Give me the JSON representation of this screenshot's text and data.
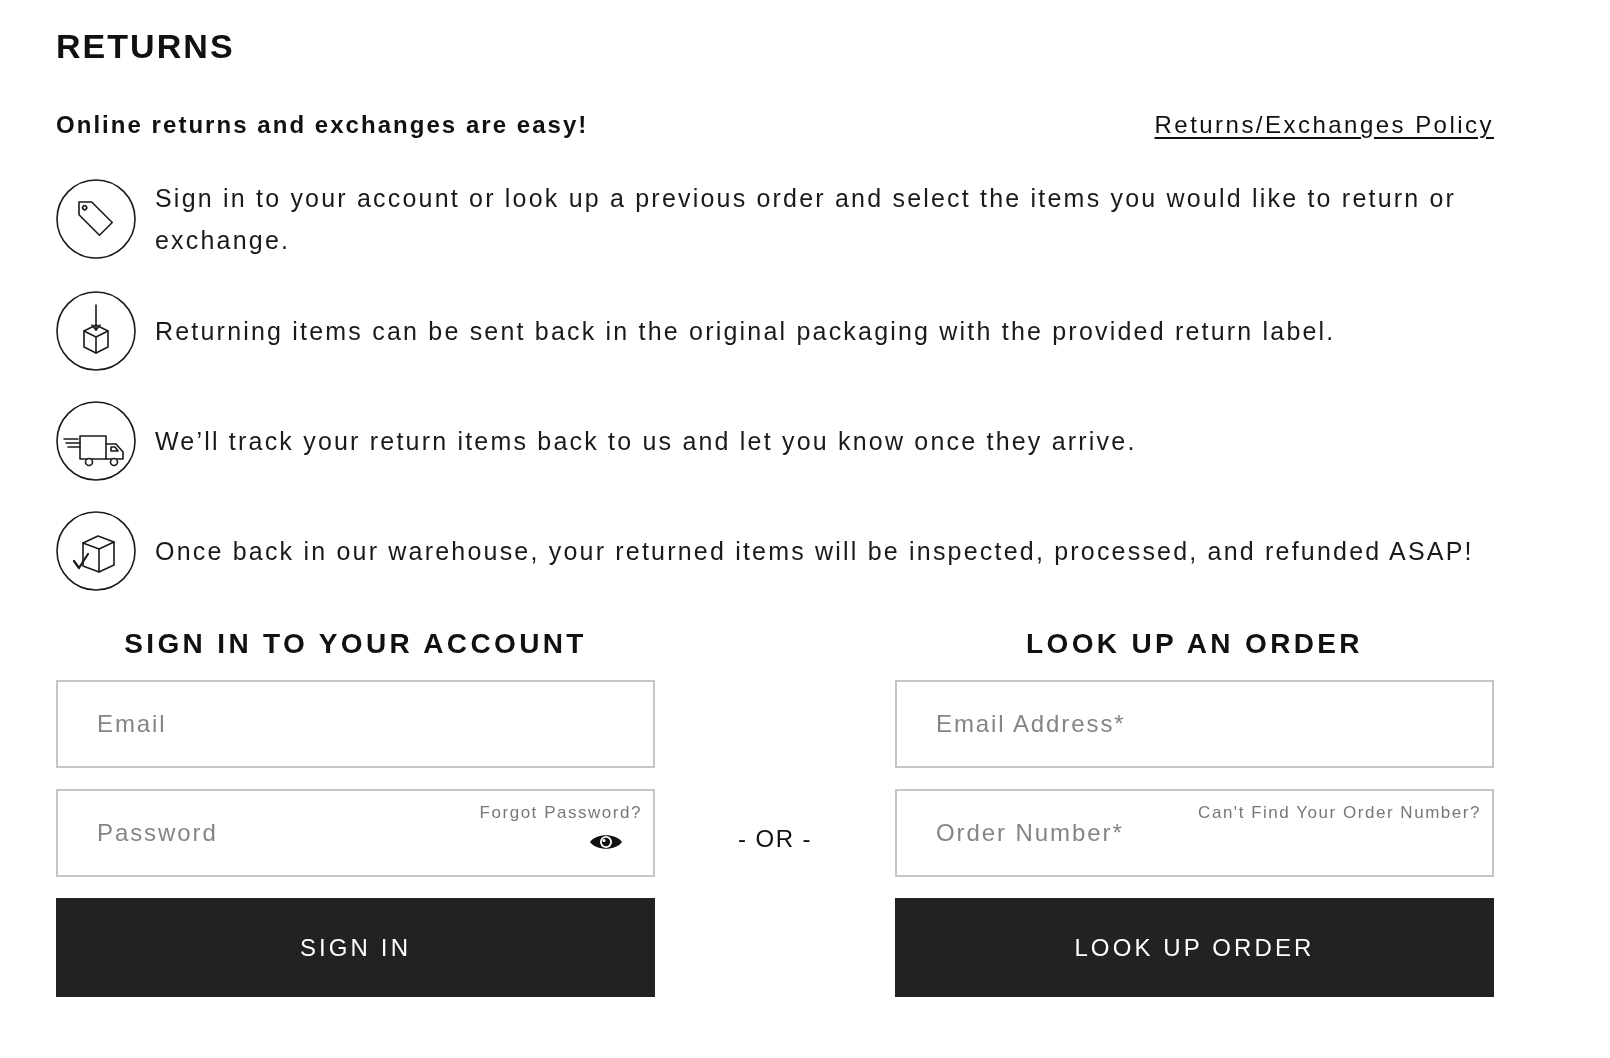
{
  "header": {
    "title": "RETURNS",
    "subtitle": "Online returns and exchanges are easy!",
    "policy_link": "Returns/Exchanges Policy"
  },
  "steps": [
    {
      "kind": "tag",
      "text": "Sign in to your account or look up a previous order and select the items you would like to return or exchange."
    },
    {
      "kind": "package",
      "text": "Returning items can be sent back in the original packaging with the provided return label."
    },
    {
      "kind": "truck",
      "text": "We’ll track your return items back to us and let you know once they arrive."
    },
    {
      "kind": "inspected",
      "text": "Once back in our warehouse, your returned items will be inspected, processed, and refunded ASAP!"
    }
  ],
  "sign_in": {
    "heading": "SIGN IN TO YOUR ACCOUNT",
    "fields": [
      {
        "placeholder": "Email",
        "password_toggle": false
      },
      {
        "placeholder": "Password",
        "help_link": "Forgot Password?",
        "password_toggle": true
      }
    ],
    "button": "SIGN IN"
  },
  "divider": "- OR -",
  "order_lookup": {
    "heading": "LOOK UP AN ORDER",
    "fields": [
      {
        "placeholder": "Email Address*",
        "password_toggle": false
      },
      {
        "placeholder": "Order Number*",
        "help_link": "Can't Find Your Order Number?",
        "password_toggle": false
      }
    ],
    "button": "LOOK UP ORDER"
  }
}
